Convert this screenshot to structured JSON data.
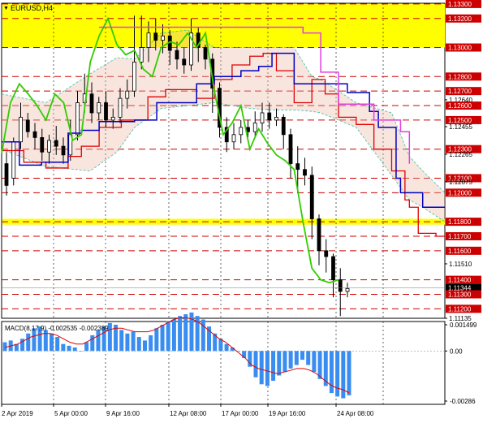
{
  "chart_data": [
    {
      "type": "line",
      "title": "EURUSD,H4",
      "style": "candlestick with Ichimoku cloud, horizontal support/resistance levels",
      "colors": {
        "background": "#ffffff",
        "label_bg": "#cc0000",
        "label_text": "#ffffff",
        "level_line": "#cc0000",
        "highlight_zone": "#ffff00",
        "tenkan": "#e00000",
        "kijun": "#0000c0",
        "chikou": "#33cc00",
        "senkou_b": "#e040e0",
        "cloud_outline": "#40c0a0",
        "cloud_fill": "#e8b4a0"
      },
      "y_axis": {
        "range": [
          1.11135,
          1.13305
        ],
        "tick_labels": [
          "1.13300",
          "1.13200",
          "1.13000",
          "1.12800",
          "1.12700",
          "1.12640",
          "1.12600",
          "1.12500",
          "1.12455",
          "1.12300",
          "1.12265",
          "1.12100",
          "1.12075",
          "1.12000",
          "1.11800",
          "1.11700",
          "1.11600",
          "1.11510",
          "1.11400",
          "1.11344",
          "1.11300",
          "1.11200",
          "1.11135"
        ]
      },
      "highlighted_levels": [
        1.133,
        1.132,
        1.13,
        1.128,
        1.127,
        1.126,
        1.125,
        1.123,
        1.121,
        1.12,
        1.118,
        1.117,
        1.116,
        1.114,
        1.113,
        1.112
      ],
      "current_price": 1.11344,
      "highlight_zones": [
        {
          "from": 1.13,
          "to": 1.133
        },
        {
          "from": 1.1178,
          "to": 1.1182
        }
      ],
      "series": [
        {
          "name": "tenkan",
          "x": [
            0,
            5,
            10,
            15,
            18,
            22,
            27,
            33,
            37,
            44,
            48,
            52,
            56,
            59,
            62,
            66,
            70,
            73,
            76,
            80,
            84,
            88,
            91,
            92,
            94,
            96,
            98,
            99,
            100
          ],
          "y": [
            1.1229,
            1.1221,
            1.1217,
            1.1225,
            1.1232,
            1.1245,
            1.125,
            1.1266,
            1.1271,
            1.1265,
            1.1278,
            1.1288,
            1.1294,
            1.1296,
            1.1284,
            1.1262,
            1.1278,
            1.1268,
            1.1252,
            1.1247,
            1.123,
            1.1215,
            1.1195,
            1.119,
            1.1172,
            1.1172,
            1.117,
            1.117,
            1.117
          ]
        },
        {
          "name": "kijun",
          "x": [
            0,
            4,
            9,
            15,
            18,
            22,
            30,
            35,
            44,
            48,
            51,
            54,
            58,
            61,
            64,
            66,
            70,
            75,
            78,
            80,
            83,
            85,
            87,
            89,
            90,
            92,
            95,
            97,
            100
          ],
          "y": [
            1.1235,
            1.1219,
            1.1221,
            1.1241,
            1.1243,
            1.1249,
            1.125,
            1.1262,
            1.1275,
            1.128,
            1.128,
            1.1284,
            1.1287,
            1.1296,
            1.1296,
            1.1275,
            1.1275,
            1.1275,
            1.1269,
            1.1269,
            1.1256,
            1.1245,
            1.1245,
            1.121,
            1.12,
            1.12,
            1.119,
            1.119,
            1.119
          ]
        },
        {
          "name": "chikou",
          "x": [
            0,
            2,
            4,
            6,
            8,
            10,
            12,
            14,
            16,
            18,
            20,
            22,
            24,
            26,
            28,
            30,
            32,
            34,
            36,
            38,
            40,
            42,
            44,
            46,
            48,
            50,
            52,
            54,
            56,
            58,
            60,
            62,
            64,
            66,
            68,
            70,
            72,
            74,
            76
          ],
          "y": [
            1.1227,
            1.1262,
            1.1275,
            1.1268,
            1.126,
            1.125,
            1.1268,
            1.1262,
            1.1236,
            1.124,
            1.129,
            1.1308,
            1.132,
            1.1302,
            1.1295,
            1.1298,
            1.1285,
            1.128,
            1.13,
            1.1304,
            1.1302,
            1.131,
            1.13,
            1.131,
            1.127,
            1.124,
            1.1248,
            1.126,
            1.123,
            1.1244,
            1.1234,
            1.1226,
            1.1222,
            1.1216,
            1.118,
            1.1148,
            1.114,
            1.1138,
            1.114
          ]
        },
        {
          "name": "senkou_b",
          "x": [
            22,
            36,
            48,
            60,
            66,
            68,
            72,
            76,
            80,
            84,
            90,
            92
          ],
          "y": [
            1.1314,
            1.1314,
            1.1314,
            1.1314,
            1.1314,
            1.131,
            1.1283,
            1.1261,
            1.1261,
            1.125,
            1.1242,
            1.122
          ]
        },
        {
          "name": "cloud_upper",
          "x": [
            0,
            10,
            20,
            26,
            30,
            36,
            42,
            48,
            56,
            62,
            66,
            70,
            72,
            80,
            88,
            92,
            95,
            100
          ],
          "y": [
            1.1268,
            1.1262,
            1.1282,
            1.1293,
            1.1292,
            1.131,
            1.1312,
            1.13,
            1.13,
            1.13,
            1.13,
            1.128,
            1.1278,
            1.1262,
            1.1255,
            1.1225,
            1.1215,
            1.12
          ]
        },
        {
          "name": "cloud_lower",
          "x": [
            0,
            10,
            20,
            26,
            30,
            36,
            42,
            48,
            56,
            62,
            66,
            70,
            72,
            80,
            88,
            92,
            95,
            100
          ],
          "y": [
            1.123,
            1.1218,
            1.1215,
            1.1228,
            1.1245,
            1.1258,
            1.126,
            1.1262,
            1.1258,
            1.1257,
            1.1257,
            1.1256,
            1.1255,
            1.1245,
            1.1212,
            1.1195,
            1.119,
            1.118
          ]
        }
      ],
      "candles": [
        [
          1.122,
          1.1205,
          1.1228,
          1.1198
        ],
        [
          1.121,
          1.1235,
          1.1238,
          1.1205
        ],
        [
          1.1235,
          1.1252,
          1.1262,
          1.123
        ],
        [
          1.125,
          1.1242,
          1.1255,
          1.1238
        ],
        [
          1.1242,
          1.1238,
          1.1248,
          1.123
        ],
        [
          1.1238,
          1.1228,
          1.1244,
          1.1222
        ],
        [
          1.1228,
          1.1236,
          1.124,
          1.122
        ],
        [
          1.1236,
          1.1232,
          1.1246,
          1.1226
        ],
        [
          1.1232,
          1.1226,
          1.1238,
          1.122
        ],
        [
          1.1226,
          1.124,
          1.125,
          1.1222
        ],
        [
          1.124,
          1.1262,
          1.127,
          1.1236
        ],
        [
          1.1262,
          1.1268,
          1.1282,
          1.1255
        ],
        [
          1.1268,
          1.1255,
          1.1276,
          1.1248
        ],
        [
          1.1255,
          1.1262,
          1.1266,
          1.125
        ],
        [
          1.1262,
          1.125,
          1.127,
          1.1245
        ],
        [
          1.125,
          1.1252,
          1.1258,
          1.1244
        ],
        [
          1.1252,
          1.1265,
          1.1272,
          1.1248
        ],
        [
          1.1265,
          1.127,
          1.1278,
          1.1258
        ],
        [
          1.127,
          1.129,
          1.1322,
          1.1266
        ],
        [
          1.129,
          1.13,
          1.1322,
          1.1285
        ],
        [
          1.13,
          1.131,
          1.1318,
          1.129
        ],
        [
          1.131,
          1.1305,
          1.132,
          1.1298
        ],
        [
          1.1305,
          1.1308,
          1.1316,
          1.1296
        ],
        [
          1.1308,
          1.1298,
          1.1312,
          1.1288
        ],
        [
          1.1298,
          1.1292,
          1.1304,
          1.1285
        ],
        [
          1.1292,
          1.1288,
          1.13,
          1.1282
        ],
        [
          1.1288,
          1.131,
          1.132,
          1.1284
        ],
        [
          1.131,
          1.13,
          1.1314,
          1.129
        ],
        [
          1.13,
          1.1292,
          1.1302,
          1.1285
        ],
        [
          1.1292,
          1.1272,
          1.1296,
          1.1255
        ],
        [
          1.1272,
          1.1245,
          1.1276,
          1.1238
        ],
        [
          1.1245,
          1.1235,
          1.1252,
          1.1228
        ],
        [
          1.1235,
          1.124,
          1.1248,
          1.123
        ],
        [
          1.124,
          1.1245,
          1.125,
          1.1234
        ],
        [
          1.1245,
          1.1242,
          1.125,
          1.1238
        ],
        [
          1.1242,
          1.1248,
          1.1256,
          1.1238
        ],
        [
          1.1248,
          1.1255,
          1.1262,
          1.1242
        ],
        [
          1.1255,
          1.125,
          1.1262,
          1.1244
        ],
        [
          1.125,
          1.1252,
          1.1258,
          1.1246
        ],
        [
          1.1252,
          1.124,
          1.1254,
          1.123
        ],
        [
          1.124,
          1.122,
          1.1244,
          1.121
        ],
        [
          1.122,
          1.1216,
          1.1232,
          1.12
        ],
        [
          1.1216,
          1.1212,
          1.1224,
          1.1205
        ],
        [
          1.1212,
          1.1182,
          1.1218,
          1.1168
        ],
        [
          1.1182,
          1.116,
          1.1185,
          1.115
        ],
        [
          1.116,
          1.1156,
          1.1168,
          1.1145
        ],
        [
          1.1156,
          1.114,
          1.1158,
          1.1128
        ],
        [
          1.114,
          1.1132,
          1.1148,
          1.1115
        ],
        [
          1.1132,
          1.1134,
          1.1138,
          1.1128
        ]
      ],
      "x_axis": {
        "tick_labels": [
          "2 Apr 2019",
          "5 Apr 00:00",
          "9 Apr 16:00",
          "12 Apr 08:00",
          "17 Apr 00:00",
          "19 Apr 16:00",
          "24 Apr 08:00"
        ]
      }
    },
    {
      "type": "bar",
      "title": "MACD(8,17,9) -0.002535 -0.002389",
      "y_axis": {
        "range": [
          -0.00286,
          0.001499
        ],
        "tick_labels": [
          "0.001499",
          "0.00",
          "-0.00286"
        ]
      },
      "histogram": [
        0.0005,
        0.0006,
        0.0004,
        0.0007,
        0.001,
        0.0013,
        0.0014,
        0.0012,
        0.001,
        0.0008,
        0.0004,
        0.0003,
        0.0002,
        0.0,
        0.0005,
        0.0009,
        0.0012,
        0.0014,
        0.0016,
        0.0015,
        0.0012,
        0.001,
        0.0011,
        0.0008,
        0.0006,
        0.0009,
        0.0013,
        0.0015,
        0.0017,
        0.0018,
        0.002,
        0.0021,
        0.0022,
        0.002,
        0.0018,
        0.0014,
        0.001,
        0.0007,
        0.0004,
        0.0002,
        0.0,
        -0.0004,
        -0.0009,
        -0.0015,
        -0.0019,
        -0.002,
        -0.0017,
        -0.0014,
        -0.0012,
        -0.001,
        -0.0008,
        -0.0005,
        -0.0008,
        -0.0012,
        -0.0016,
        -0.002,
        -0.0024,
        -0.0026,
        -0.0027,
        -0.00253
      ],
      "signal": [
        0.0002,
        0.0003,
        0.0004,
        0.0006,
        0.0008,
        0.0009,
        0.001,
        0.001,
        0.0009,
        0.0007,
        0.0005,
        0.0004,
        0.0004,
        0.0006,
        0.0008,
        0.001,
        0.0012,
        0.0013,
        0.0013,
        0.0012,
        0.0011,
        0.0011,
        0.0011,
        0.0012,
        0.0014,
        0.0016,
        0.0018,
        0.0019,
        0.0019,
        0.0018,
        0.0016,
        0.0013,
        0.001,
        0.0007,
        0.0005,
        0.0002,
        -0.0001,
        -0.0004,
        -0.0008,
        -0.001,
        -0.0011,
        -0.0012,
        -0.0013,
        -0.0012,
        -0.0011,
        -0.001,
        -0.001,
        -0.0011,
        -0.0013,
        -0.0016,
        -0.0019,
        -0.0021,
        -0.0022,
        -0.002389
      ]
    }
  ]
}
